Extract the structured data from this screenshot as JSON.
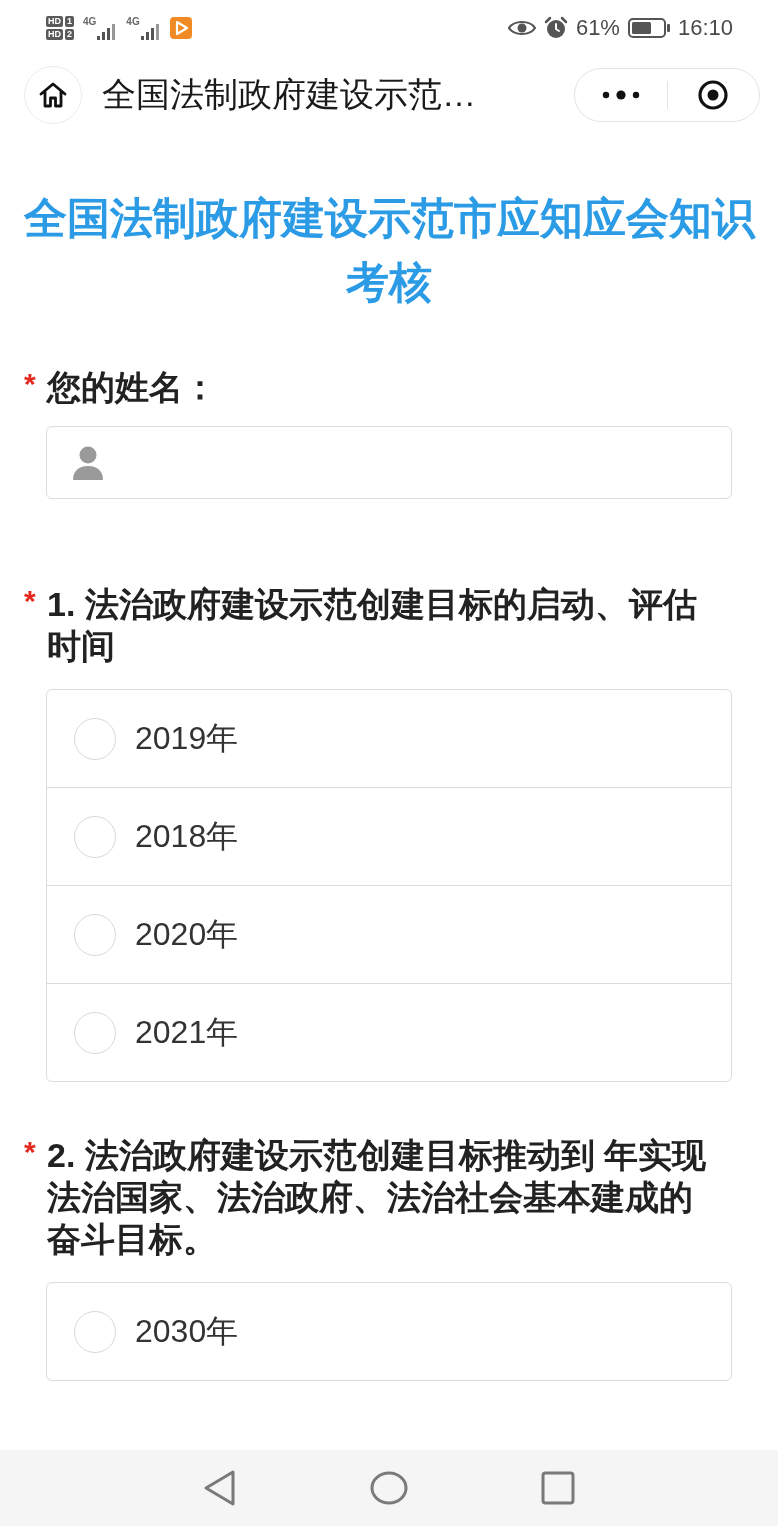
{
  "status_bar": {
    "sims": [
      {
        "badge": "HD",
        "slot": "1"
      },
      {
        "badge": "HD",
        "slot": "2"
      }
    ],
    "networks": [
      {
        "type": "4G"
      },
      {
        "type": "4G"
      }
    ],
    "battery": "61%",
    "time": "16:10"
  },
  "header": {
    "title": "全国法制政府建设示范…"
  },
  "page": {
    "title": "全国法制政府建设示范市应知应会知识考核"
  },
  "form": {
    "name_field": {
      "marker": "*",
      "label": "您的姓名："
    },
    "questions": [
      {
        "marker": "*",
        "title": "1. 法治政府建设示范创建目标的启动、评估时间",
        "options": [
          {
            "label": "2019年",
            "selected": false
          },
          {
            "label": "2018年",
            "selected": false
          },
          {
            "label": "2020年",
            "selected": false
          },
          {
            "label": "2021年",
            "selected": false
          }
        ]
      },
      {
        "marker": "*",
        "title": "2. 法治政府建设示范创建目标推动到 年实现法治国家、法治政府、法治社会基本建成的奋斗目标。",
        "options": [
          {
            "label": "2030年",
            "selected": false
          }
        ]
      }
    ]
  }
}
